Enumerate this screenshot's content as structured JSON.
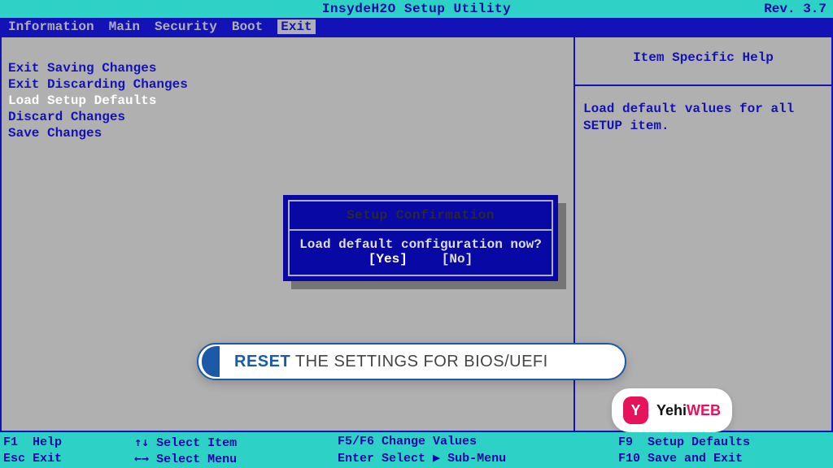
{
  "title": "InsydeH2O Setup Utility",
  "revision": "Rev. 3.7",
  "menu": {
    "items": [
      "Information",
      "Main",
      "Security",
      "Boot",
      "Exit"
    ],
    "active": "Exit"
  },
  "options": [
    {
      "label": "Exit Saving Changes",
      "selected": false
    },
    {
      "label": "Exit Discarding Changes",
      "selected": false
    },
    {
      "label": "Load Setup Defaults",
      "selected": true
    },
    {
      "label": "Discard Changes",
      "selected": false
    },
    {
      "label": "Save Changes",
      "selected": false
    }
  ],
  "help": {
    "title": "Item Specific Help",
    "body": "Load default values for all SETUP item."
  },
  "dialog": {
    "title": "Setup Confirmation",
    "message": "Load default configuration now?",
    "buttons": {
      "yes": "[Yes]",
      "no": "[No]"
    },
    "selected": "yes"
  },
  "annotation": {
    "strong": "RESET",
    "rest": " THE SETTINGS FOR BIOS/UEFI"
  },
  "watermark": {
    "logo_glyph": "Y",
    "text_part1": "Yehi",
    "text_part2": "WEB"
  },
  "footer": {
    "col1": [
      {
        "key": "F1",
        "desc": "Help"
      },
      {
        "key": "Esc",
        "desc": "Exit"
      }
    ],
    "col2": [
      {
        "key": "↑↓",
        "desc": "Select Item"
      },
      {
        "key": "←→",
        "desc": "Select Menu"
      }
    ],
    "col3": [
      {
        "key": "F5/F6",
        "desc": "Change Values"
      },
      {
        "key": "Enter",
        "desc": "Select ▶ Sub-Menu"
      }
    ],
    "col4": [
      {
        "key": "F9",
        "desc": "Setup Defaults"
      },
      {
        "key": "F10",
        "desc": "Save and Exit"
      }
    ]
  }
}
